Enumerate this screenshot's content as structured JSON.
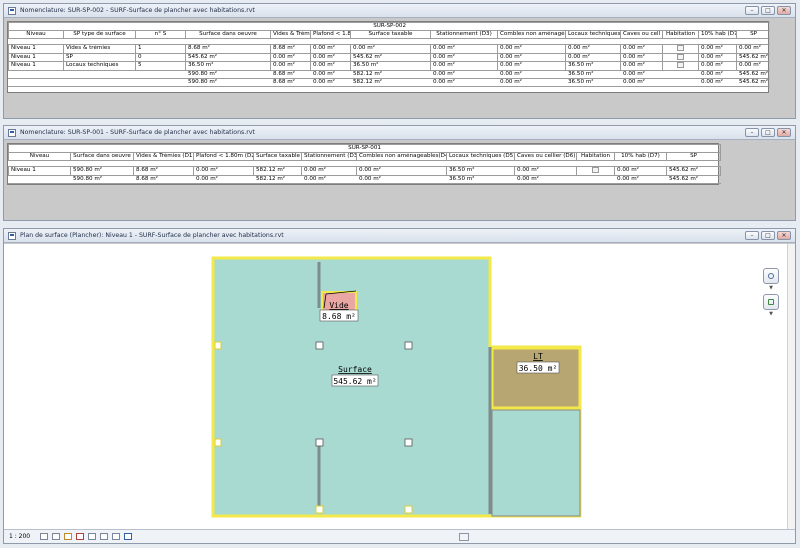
{
  "window1": {
    "title": "Nomenclature: SUR-SP-002 - SURF-Surface de plancher avec habitations.rvt",
    "sheet_title": "SUR-SP-002",
    "headers": [
      "Niveau",
      "SP type de surface",
      "n° S",
      "Surface dans oeuvre",
      "Vides & Trém",
      "Plafond < 1.8",
      "Surface taxable",
      "Stationnement (D3)",
      "Combles non aménagé",
      "Locaux techniques",
      "Caves ou cell",
      "Habitation",
      "10% hab (D7)",
      "SP"
    ],
    "rows": [
      [
        "Niveau 1",
        "Vides & trémies",
        "1",
        "8.68 m²",
        "8.68 m²",
        "0.00 m²",
        "0.00 m²",
        "0.00 m²",
        "0.00 m²",
        "0.00 m²",
        "0.00 m²",
        "",
        "0.00 m²",
        "0.00 m²"
      ],
      [
        "Niveau 1",
        "SP",
        "0",
        "545.62 m²",
        "0.00 m²",
        "0.00 m²",
        "545.62 m²",
        "0.00 m²",
        "0.00 m²",
        "0.00 m²",
        "0.00 m²",
        "",
        "0.00 m²",
        "545.62 m²"
      ],
      [
        "Niveau 1",
        "Locaux techniques",
        "5",
        "36.50 m²",
        "0.00 m²",
        "0.00 m²",
        "36.50 m²",
        "0.00 m²",
        "0.00 m²",
        "36.50 m²",
        "0.00 m²",
        "",
        "0.00 m²",
        "0.00 m²"
      ]
    ],
    "sums": [
      [
        "",
        "",
        "",
        "590.80 m²",
        "8.68 m²",
        "0.00 m²",
        "582.12 m²",
        "0.00 m²",
        "0.00 m²",
        "36.50 m²",
        "0.00 m²",
        "",
        "0.00 m²",
        "545.62 m²"
      ],
      [
        "",
        "",
        "",
        "590.80 m²",
        "8.68 m²",
        "0.00 m²",
        "582.12 m²",
        "0.00 m²",
        "0.00 m²",
        "36.50 m²",
        "0.00 m²",
        "",
        "0.00 m²",
        "545.62 m²"
      ]
    ]
  },
  "window2": {
    "title": "Nomenclature: SUR-SP-001 - SURF-Surface de plancher avec habitations.rvt",
    "sheet_title": "SUR-SP-001",
    "headers": [
      "Niveau",
      "Surface dans oeuvre",
      "Vides & Trémies (D1)",
      "Plafond < 1.80m (D2)",
      "Surface taxable",
      "Stationnement (D3)",
      "Combles non aménageables(D4)",
      "Locaux techniques (D5)",
      "Caves ou cellier (D6)",
      "Habitation",
      "10% hab (D7)",
      "SP"
    ],
    "rows": [
      [
        "Niveau 1",
        "590.80 m²",
        "8.68 m²",
        "0.00 m²",
        "582.12 m²",
        "0.00 m²",
        "0.00 m²",
        "36.50 m²",
        "0.00 m²",
        "",
        "0.00 m²",
        "545.62 m²"
      ]
    ],
    "sums": [
      [
        "",
        "590.80 m²",
        "8.68 m²",
        "0.00 m²",
        "582.12 m²",
        "0.00 m²",
        "0.00 m²",
        "36.50 m²",
        "0.00 m²",
        "",
        "0.00 m²",
        "545.62 m²"
      ]
    ]
  },
  "window3": {
    "title": "Plan de surface (Plancher): Niveau 1 - SURF-Surface de plancher avec habitations.rvt",
    "tags": {
      "vide_name": "Vide",
      "vide_area": "8.68 m²",
      "surface_name": "Surface",
      "surface_area": "545.62 m²",
      "lt_name": "LT",
      "lt_area": "36.50 m²"
    },
    "colors": {
      "surface_fill": "#a9dad2",
      "lt_fill": "#b8a672",
      "vide_fill": "#e9a6a2",
      "boundary": "#f3ea4a"
    },
    "status": {
      "scale": "1 : 200"
    }
  },
  "window_buttons": {
    "minimize": "–",
    "maximize": "□",
    "close": "✕"
  }
}
